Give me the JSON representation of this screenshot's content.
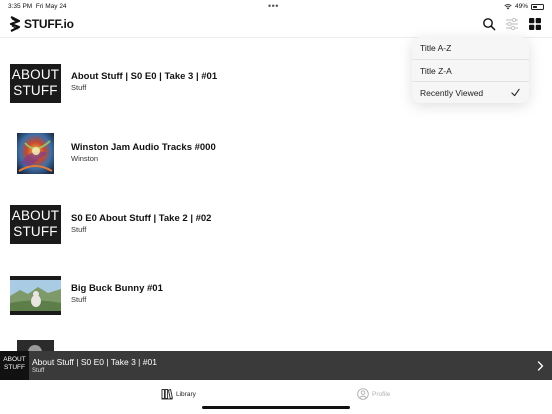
{
  "status_bar": {
    "time": "3:35 PM",
    "date": "Fri May 24",
    "battery_percent": "49%",
    "battery_level": 0.49
  },
  "header": {
    "logo_text": "STUFF.io",
    "search_icon": "search-icon",
    "filter_icon": "filter-sliders-icon",
    "grid_icon": "grid-view-icon"
  },
  "sort_menu": {
    "items": [
      {
        "label": "Title A-Z",
        "selected": false
      },
      {
        "label": "Title Z-A",
        "selected": false
      },
      {
        "label": "Recently Viewed",
        "selected": true
      }
    ]
  },
  "library": {
    "items": [
      {
        "title": "About Stuff | S0 E0 | Take 3 |  #01",
        "subtitle": "Stuff",
        "thumb": "about-stuff",
        "thumb_text_1": "ABOUT",
        "thumb_text_2": "STUFF"
      },
      {
        "title": "Winston Jam Audio Tracks #000",
        "subtitle": "Winston",
        "thumb": "art"
      },
      {
        "title": "S0 E0 About Stuff | Take 2 |  #02",
        "subtitle": "Stuff",
        "thumb": "about-stuff",
        "thumb_text_1": "ABOUT",
        "thumb_text_2": "STUFF"
      },
      {
        "title": "Big Buck Bunny #01",
        "subtitle": "Stuff",
        "thumb": "landscape"
      },
      {
        "title": "",
        "subtitle": "",
        "thumb": "partial"
      }
    ]
  },
  "mini_player": {
    "thumb_text_1": "ABOUT",
    "thumb_text_2": "STUFF",
    "title": "About Stuff | S0 E0 | Take 3 |  #01",
    "subtitle": "Stuff"
  },
  "tab_bar": {
    "tabs": [
      {
        "label": "Library",
        "icon": "library-icon",
        "active": true
      },
      {
        "label": "Profile",
        "icon": "profile-icon",
        "active": false
      }
    ]
  },
  "colors": {
    "accent": "#111111",
    "mini_player_bg": "#3a3a3a",
    "inactive_tab": "#b0b0b0"
  }
}
